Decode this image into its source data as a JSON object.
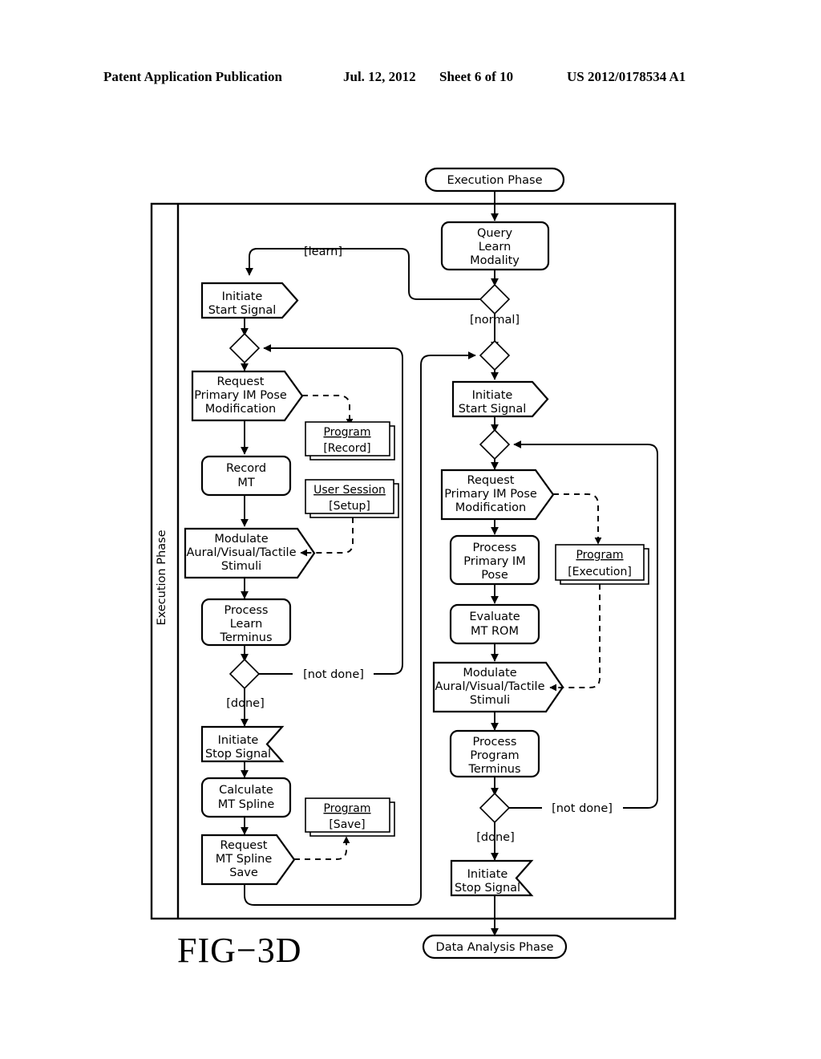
{
  "header": {
    "publication": "Patent Application Publication",
    "date": "Jul. 12, 2012",
    "sheet": "Sheet 6 of 10",
    "number": "US 2012/0178534 A1"
  },
  "figure": {
    "label": "FIG−3D",
    "type": "uml-activity-diagram",
    "swimlane_label": "Execution  Phase"
  },
  "nodes": {
    "start": {
      "label": "Execution  Phase",
      "shape": "rounded-terminal"
    },
    "end": {
      "label": "Data  Analysis  Phase",
      "shape": "rounded-terminal"
    },
    "query_learn_modality": {
      "line1": "Query",
      "line2": "Learn",
      "line3": "Modality",
      "shape": "rounded-rect"
    },
    "left_initiate_start": {
      "line1": "Initiate",
      "line2": "Start  Signal",
      "shape": "signal-send"
    },
    "left_request_pose": {
      "line1": "Request",
      "line2": "Primary  IM  Pose",
      "line3": "Modification",
      "shape": "signal-send"
    },
    "left_record_mt": {
      "line1": "Record",
      "line2": "MT",
      "shape": "rounded-rect"
    },
    "left_modulate": {
      "line1": "Modulate",
      "line2": "Aural/Visual/Tactile",
      "line3": "Stimuli",
      "shape": "signal-receive"
    },
    "left_process_learn": {
      "line1": "Process",
      "line2": "Learn",
      "line3": "Terminus",
      "shape": "rounded-rect"
    },
    "left_initiate_stop": {
      "line1": "Initiate",
      "line2": "Stop  Signal",
      "shape": "signal-receive"
    },
    "left_calculate_spline": {
      "line1": "Calculate",
      "line2": "MT  Spline",
      "shape": "rounded-rect"
    },
    "left_request_save": {
      "line1": "Request",
      "line2": "MT  Spline",
      "line3": "Save",
      "shape": "signal-send"
    },
    "artifact_program_record": {
      "title": "Program ",
      "state": "[Record]",
      "shape": "object-stack"
    },
    "artifact_user_session": {
      "title": "User  Session",
      "state": "[Setup]",
      "shape": "object-stack"
    },
    "artifact_program_save": {
      "title": "Program ",
      "state": "[Save]",
      "shape": "object-stack"
    },
    "artifact_program_execution": {
      "title": "Program ",
      "state": "[Execution]",
      "shape": "object-stack"
    },
    "right_initiate_start": {
      "line1": "Initiate",
      "line2": "Start  Signal",
      "shape": "signal-send"
    },
    "right_request_pose": {
      "line1": "Request",
      "line2": "Primary  IM  Pose",
      "line3": "Modification",
      "shape": "signal-send"
    },
    "right_process_pose": {
      "line1": "Process",
      "line2": "Primary  IM",
      "line3": "Pose",
      "shape": "rounded-rect"
    },
    "right_evaluate_rom": {
      "line1": "Evaluate",
      "line2": "MT  ROM",
      "shape": "rounded-rect"
    },
    "right_modulate": {
      "line1": "Modulate",
      "line2": "Aural/Visual/Tactile",
      "line3": "Stimuli",
      "shape": "signal-receive"
    },
    "right_process_program": {
      "line1": "Process",
      "line2": "Program",
      "line3": "Terminus",
      "shape": "rounded-rect"
    },
    "right_initiate_stop": {
      "line1": "Initiate",
      "line2": "Stop  Signal",
      "shape": "signal-receive"
    }
  },
  "guards": {
    "learn": "[learn]",
    "normal": "[normal]",
    "left_not_done": "[not  done]",
    "left_done": "[done]",
    "right_not_done": "[not  done]",
    "right_done": "[done]"
  },
  "colors": {
    "ink": "#000000",
    "paper": "#ffffff"
  }
}
